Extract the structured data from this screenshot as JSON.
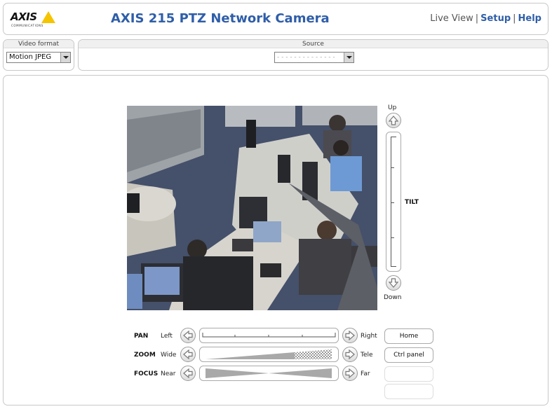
{
  "header": {
    "logo_text": "AXIS",
    "logo_sub": "COMMUNICATIONS",
    "title": "AXIS 215 PTZ Network Camera",
    "nav": {
      "live_view": "Live View",
      "setup": "Setup",
      "help": "Help",
      "separator": "|"
    }
  },
  "video_format": {
    "legend": "Video format",
    "selected": "Motion JPEG"
  },
  "source": {
    "legend": "Source",
    "selected": "- - - - - - - - - - - - - -"
  },
  "tilt": {
    "up_label": "Up",
    "down_label": "Down",
    "label": "TILT"
  },
  "controls": {
    "pan": {
      "label": "PAN",
      "left": "Left",
      "right": "Right"
    },
    "zoom": {
      "label": "ZOOM",
      "left": "Wide",
      "right": "Tele"
    },
    "focus": {
      "label": "FOCUS",
      "left": "Near",
      "right": "Far"
    }
  },
  "buttons": {
    "home": "Home",
    "ctrl_panel": "Ctrl panel"
  },
  "colors": {
    "title_blue": "#2f5ea8",
    "logo_yellow": "#f5c400",
    "border_gray": "#c8c8c8"
  }
}
